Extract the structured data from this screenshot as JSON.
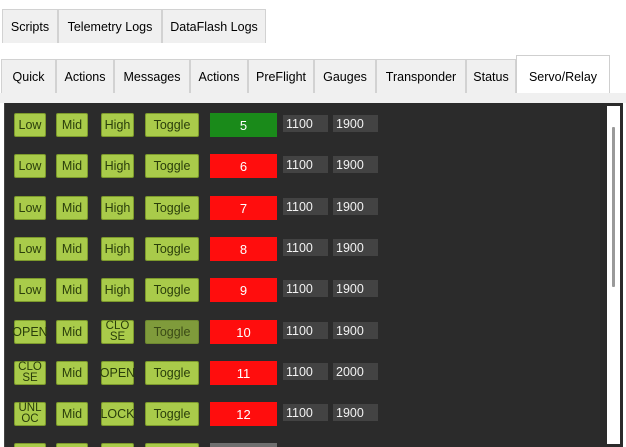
{
  "tabs_row1": [
    {
      "label": "Scripts",
      "active": false
    },
    {
      "label": "Telemetry Logs",
      "active": false
    },
    {
      "label": "DataFlash Logs",
      "active": false
    }
  ],
  "tabs_row2": [
    {
      "label": "Quick",
      "active": false
    },
    {
      "label": "Actions",
      "active": false
    },
    {
      "label": "Messages",
      "active": false
    },
    {
      "label": "Actions",
      "active": false
    },
    {
      "label": "PreFlight",
      "active": false
    },
    {
      "label": "Gauges",
      "active": false
    },
    {
      "label": "Transponder",
      "active": false
    },
    {
      "label": "Status",
      "active": false
    },
    {
      "label": "Servo/Relay",
      "active": true
    }
  ],
  "colors": {
    "active_channel": "#1a8a1a",
    "inactive_channel": "#ff0d0d",
    "button": "#a9cb4a",
    "field": "#434343"
  },
  "servos": [
    {
      "b1": "Low",
      "b2": "Mid",
      "b3": "High",
      "toggle": "Toggle",
      "channel": "5",
      "state": "active",
      "low": "1100",
      "high": "1900"
    },
    {
      "b1": "Low",
      "b2": "Mid",
      "b3": "High",
      "toggle": "Toggle",
      "channel": "6",
      "state": "inactive",
      "low": "1100",
      "high": "1900"
    },
    {
      "b1": "Low",
      "b2": "Mid",
      "b3": "High",
      "toggle": "Toggle",
      "channel": "7",
      "state": "inactive",
      "low": "1100",
      "high": "1900"
    },
    {
      "b1": "Low",
      "b2": "Mid",
      "b3": "High",
      "toggle": "Toggle",
      "channel": "8",
      "state": "inactive",
      "low": "1100",
      "high": "1900"
    },
    {
      "b1": "Low",
      "b2": "Mid",
      "b3": "High",
      "toggle": "Toggle",
      "channel": "9",
      "state": "inactive",
      "low": "1100",
      "high": "1900"
    },
    {
      "b1": "OPEN",
      "b2": "Mid",
      "b3": "CLOSE",
      "toggle": "Toggle",
      "toggle_dim": true,
      "channel": "10",
      "state": "inactive",
      "low": "1100",
      "high": "1900"
    },
    {
      "b1": "CLOSE",
      "b2": "Mid",
      "b3": "OPEN",
      "toggle": "Toggle",
      "channel": "11",
      "state": "inactive",
      "low": "1100",
      "high": "2000"
    },
    {
      "b1": "UNLOC",
      "b2": "Mid",
      "b3": "LOCK",
      "toggle": "Toggle",
      "channel": "12",
      "state": "inactive",
      "low": "1100",
      "high": "1900"
    }
  ]
}
